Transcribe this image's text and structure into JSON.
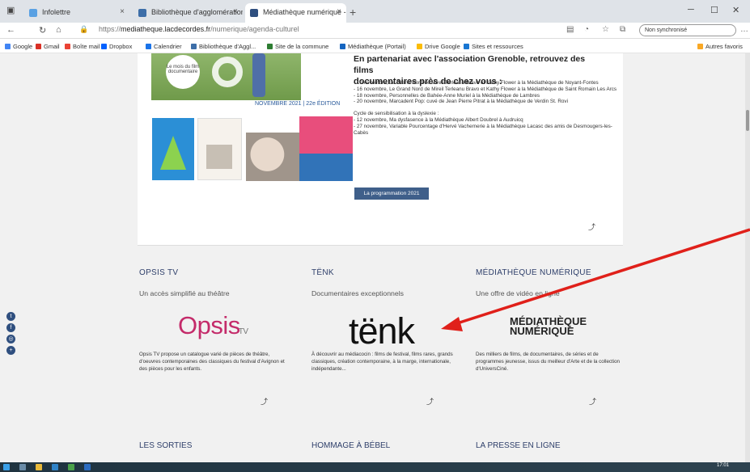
{
  "browser": {
    "tabs": [
      {
        "title": "Infolettre"
      },
      {
        "title": "Bibliothèque d'agglomération"
      },
      {
        "title": "Médiathèque numérique - Agglo"
      }
    ],
    "url_prefix": "https://",
    "url_domain": "mediatheque.lacdecordes.fr",
    "url_path": "/numerique/agenda-culturel",
    "profile_label": "Non synchronisé"
  },
  "bookmarks": [
    {
      "label": "Google",
      "color": "#4285f4"
    },
    {
      "label": "Gmail",
      "color": "#d93025"
    },
    {
      "label": "Boîte mail",
      "color": "#ea4335"
    },
    {
      "label": "Dropbox",
      "color": "#0061ff"
    },
    {
      "label": "Calendrier",
      "color": "#1a73e8"
    },
    {
      "label": "Bibliothèque d'Aggl...",
      "color": "#3d6ea8"
    },
    {
      "label": "Site de la commune",
      "color": "#2e7d32"
    },
    {
      "label": "Médiathèque (Portail)",
      "color": "#1565c0"
    },
    {
      "label": "Drive Google",
      "color": "#fbbc04"
    },
    {
      "label": "Sites et ressources",
      "color": "#1976d2"
    },
    {
      "label": "Autres favoris",
      "color": "#f9a825"
    }
  ],
  "article": {
    "intro_line": "En partenariat avec l'association Grenoble, retrouvez des films",
    "heading": "documentaires près de chez vous :",
    "poster_tag": "Le mois du film documentaire",
    "date_line": "NOVEMBRE 2021 | 22e ÉDITION",
    "events": [
      "- 10 novembre, Le Grand Nord de Mireil Terleanu Bravo et Kathy Flower à la Médiathèque de Noyant-Fontes",
      "- 16 novembre, Le Grand Nord de Mireil Terleanu Bravo et Kathy Flower à la Médiathèque de Saint Romain Les Arcs",
      "- 18 novembre, Personnelles de Bahée-Anne Muriel à la Médiathèque de Lambres",
      "- 20 novembre, Marcadent Pop: cuvé de Jean Pierre Pitrat à la Médiathèque de Verdin St. Rovi",
      "",
      "Cycle de sensibilisation à la dyslexie :",
      "- 12 novembre, Ma dysfasence à la Médiathèque Albert Doubrel à Audruicq",
      "- 27 novembre, Variable Pourcentage d'Hervé Vachernerie à la Médiathèque Lacasc des amis de Desmougers-les-Cabès"
    ],
    "button": "La programmation 2021"
  },
  "sections": [
    {
      "title": "OPSIS TV",
      "subtitle": "Un accès simplifié au théâtre",
      "logo_main": "Opsis",
      "logo_sub": "TV",
      "description": "Opsis TV propose un catalogue varié de pièces de théâtre, d'oeuvres contemporaines des classiques du festival d'Avignon et des pièces pour les enfants."
    },
    {
      "title": "TËNK",
      "subtitle": "Documentaires exceptionnels",
      "logo_main": "tënk",
      "description": "À découvrir au médiacocin : films de festival, films rares, grands classiques, création contemporaine, à la marge, internationale, indépendante..."
    },
    {
      "title": "MÉDIATHÈQUE NUMÉRIQUE",
      "subtitle": "Une offre de vidéo en ligne",
      "logo_line1": "MÉDIATHÈQUE",
      "logo_line2": "NUMÉRIQUE",
      "description": "Des milliers de films, de documentaires, de séries et de programmes jeunesse, issus du meilleur d'Arte et de la collection d'UniversCiné."
    }
  ],
  "bottom_titles": [
    "LES SORTIES",
    "HOMMAGE À BÉBEL",
    "LA PRESSE EN LIGNE"
  ],
  "social": [
    "twitter-icon",
    "facebook-icon",
    "instagram-icon",
    "share-icon"
  ],
  "clock": "17:01",
  "annotation_arrow_color": "#e0201a"
}
